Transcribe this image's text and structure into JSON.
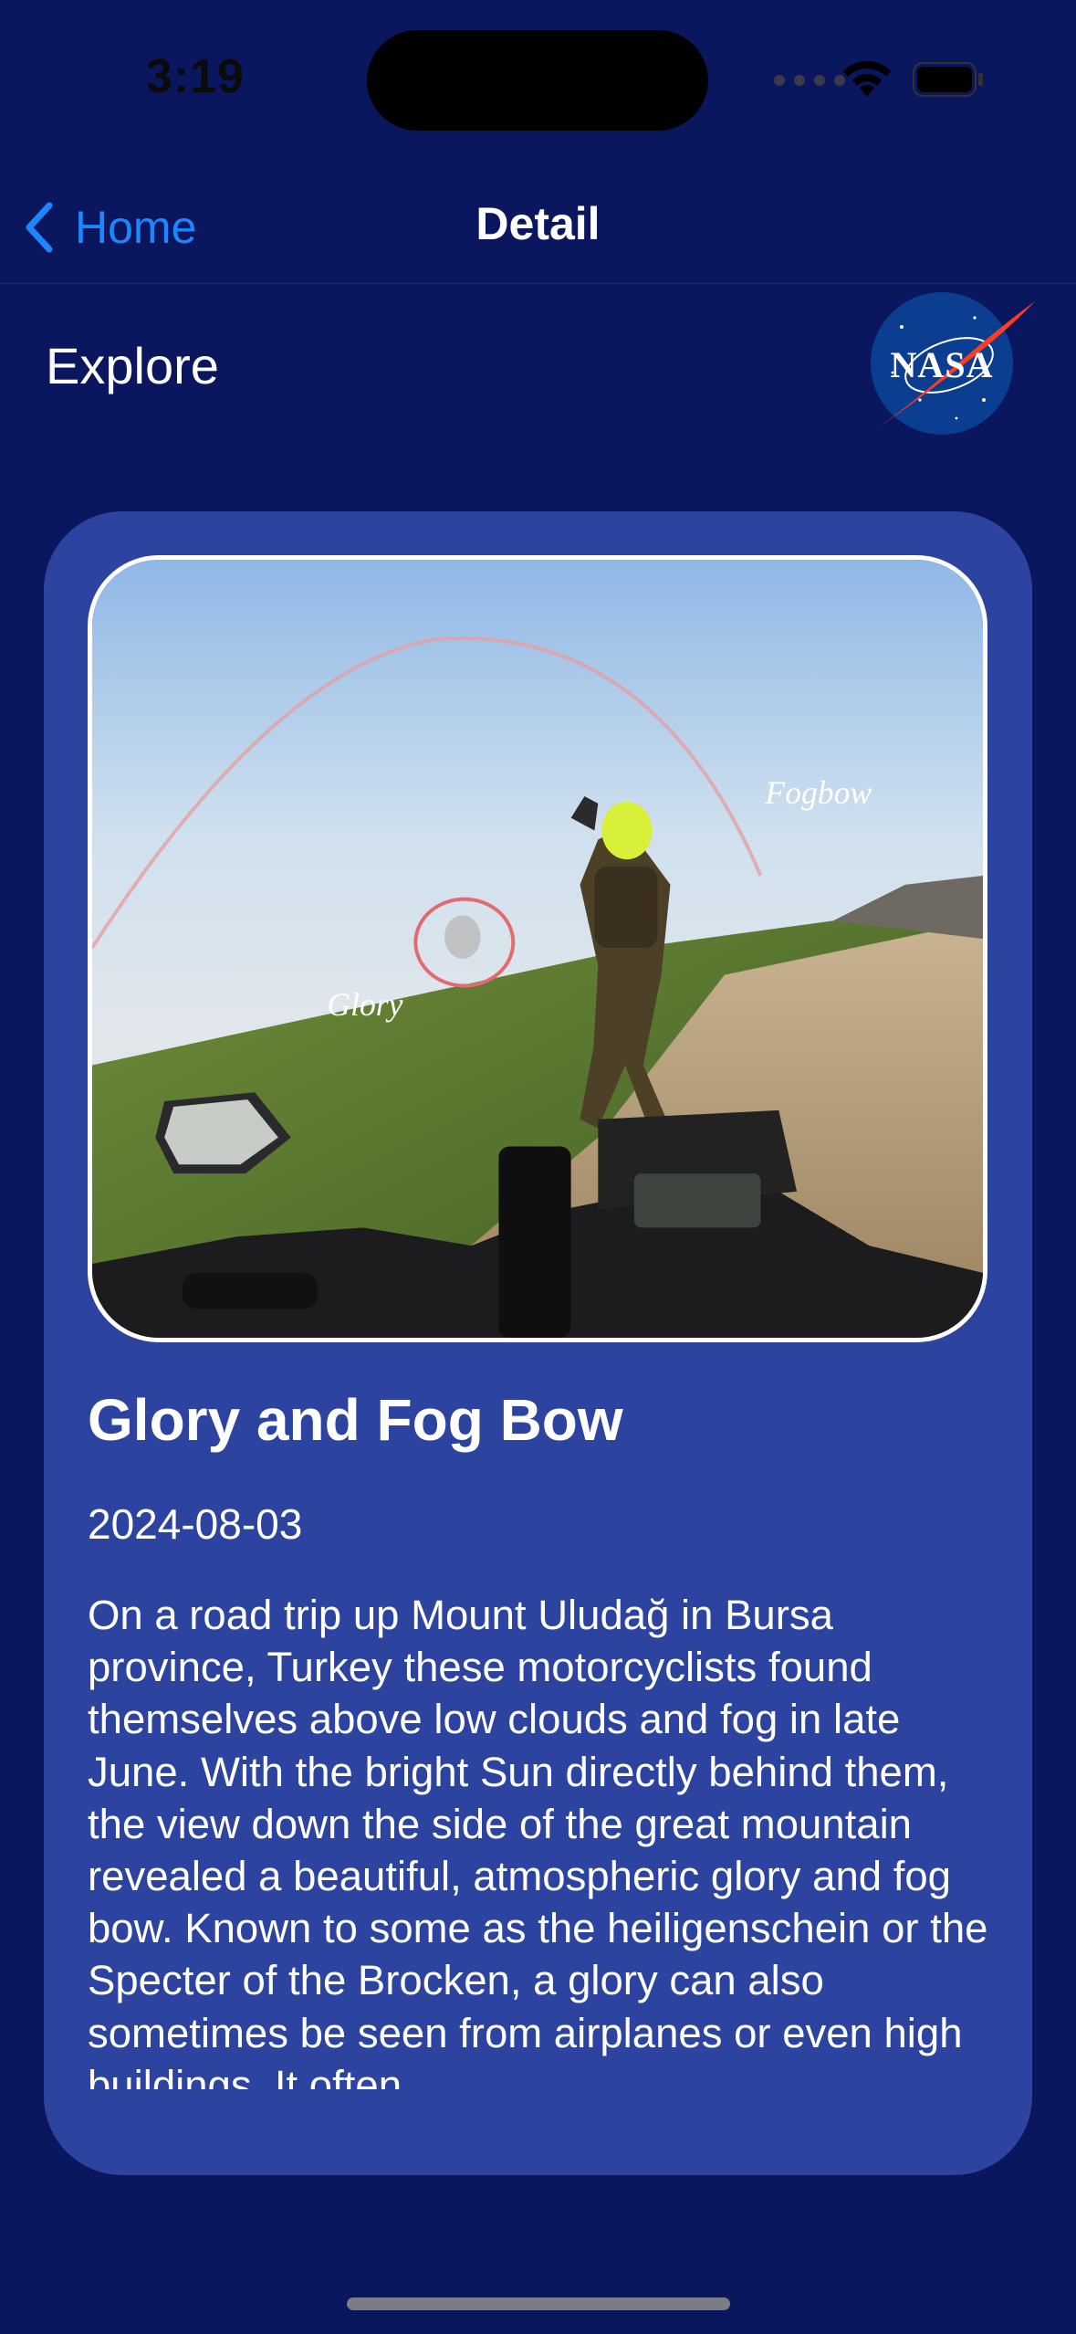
{
  "status_bar": {
    "time": "3:19",
    "icons": [
      "cellular-signal-icon",
      "wifi-icon",
      "battery-icon"
    ]
  },
  "nav": {
    "back_label": "Home",
    "title": "Detail"
  },
  "header": {
    "section_label": "Explore",
    "logo_text": "NASA"
  },
  "card": {
    "image_labels": {
      "fogbow": "Fogbow",
      "glory": "Glory"
    },
    "title": "Glory and Fog Bow",
    "date": "2024-08-03",
    "description": "On a road trip up Mount Uludağ in Bursa province, Turkey these motorcyclists found themselves above low clouds and fog in late June. With the bright Sun directly behind them, the view down the side of the great mountain revealed a beautiful, atmospheric glory and fog bow. Known to some as the heiligenschein or the Specter of the Brocken, a glory can also sometimes be seen from airplanes or even high buildings. It often"
  },
  "colors": {
    "background": "#0a175e",
    "card": "#2c44a0",
    "accent": "#1d86ff",
    "nasa_blue": "#0b3d91",
    "nasa_red": "#fc3d21"
  }
}
